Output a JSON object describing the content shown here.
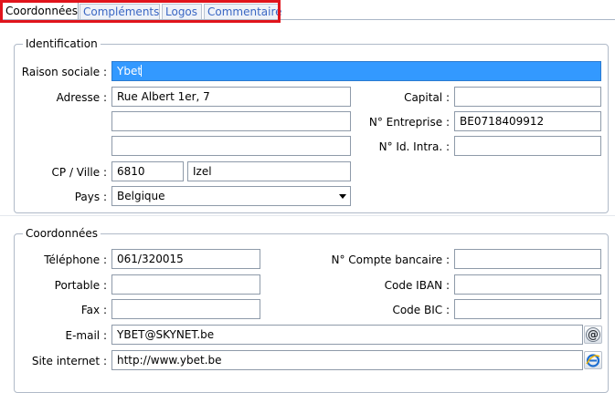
{
  "tabs": [
    {
      "label": "Coordonnées",
      "active": true
    },
    {
      "label": "Compléments",
      "active": false
    },
    {
      "label": "Logos",
      "active": false
    },
    {
      "label": "Commentaire",
      "active": false
    }
  ],
  "identification": {
    "title": "Identification",
    "raison_sociale": {
      "label": "Raison sociale :",
      "value": "Ybet"
    },
    "adresse": {
      "label": "Adresse :",
      "line1": "Rue Albert 1er, 7",
      "line2": "",
      "line3": ""
    },
    "cp_ville": {
      "label": "CP / Ville :",
      "cp": "6810",
      "ville": "Izel"
    },
    "pays": {
      "label": "Pays :",
      "value": "Belgique"
    },
    "capital": {
      "label": "Capital :",
      "value": ""
    },
    "n_entreprise": {
      "label": "N° Entreprise :",
      "value": "BE0718409912"
    },
    "n_id_intra": {
      "label": "N° Id. Intra. :",
      "value": ""
    }
  },
  "coordonnees": {
    "title": "Coordonnées",
    "telephone": {
      "label": "Téléphone :",
      "value": "061/320015"
    },
    "portable": {
      "label": "Portable :",
      "value": ""
    },
    "fax": {
      "label": "Fax :",
      "value": ""
    },
    "email": {
      "label": "E-mail :",
      "value": "YBET@SKYNET.be"
    },
    "site": {
      "label": "Site internet :",
      "value": "http://www.ybet.be"
    },
    "compte": {
      "label": "N° Compte bancaire :",
      "value": ""
    },
    "iban": {
      "label": "Code IBAN :",
      "value": ""
    },
    "bic": {
      "label": "Code BIC :",
      "value": ""
    }
  },
  "icons": {
    "email_button": "at-sign-icon",
    "site_button": "internet-explorer-icon"
  },
  "colors": {
    "highlight": "#e0141c",
    "selection": "#3399ff",
    "tab_text": "#3a67c4"
  }
}
